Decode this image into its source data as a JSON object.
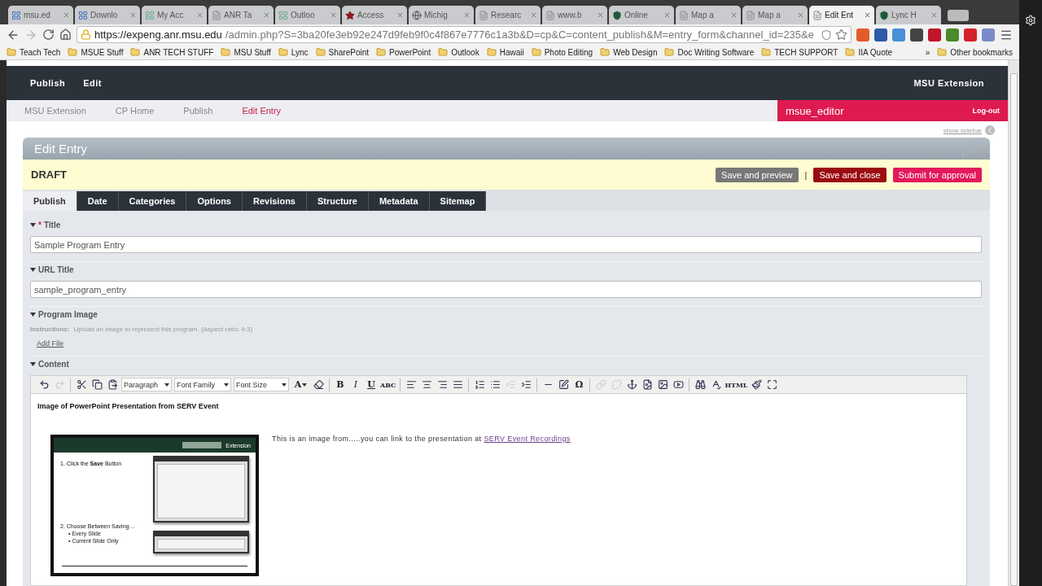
{
  "browser": {
    "tabs": [
      {
        "title": "msu.ed",
        "selected": false
      },
      {
        "title": "Downlo",
        "selected": false
      },
      {
        "title": "My Acc",
        "selected": false
      },
      {
        "title": "ANR Ta",
        "selected": false
      },
      {
        "title": "Outloo",
        "selected": false
      },
      {
        "title": "Access",
        "selected": false
      },
      {
        "title": "Michig",
        "selected": false
      },
      {
        "title": "Researc",
        "selected": false
      },
      {
        "title": "www.b",
        "selected": false
      },
      {
        "title": "Online",
        "selected": false
      },
      {
        "title": "Map a",
        "selected": false
      },
      {
        "title": "Map a",
        "selected": false
      },
      {
        "title": "Edit Ent",
        "selected": true
      },
      {
        "title": "Lync H",
        "selected": false
      }
    ],
    "url_host": "https://expeng.anr.msu.edu",
    "url_path": "/admin.php?S=3ba20fe3eb92e247d9feb9f0c4f867e7776c1a3b&D=cp&C=content_publish&M=entry_form&channel_id=235&e",
    "bookmarks": [
      "Teach Tech",
      "MSUE Stuff",
      "ANR TECH STUFF",
      "MSU Stuff",
      "Lync",
      "SharePoint",
      "PowerPoint",
      "Outlook",
      "Hawaii",
      "Photo Editing",
      "Web Design",
      "Doc Writing Software",
      "TECH SUPPORT",
      "IIA Quote"
    ],
    "more": "»",
    "other_bookmarks": "Other bookmarks"
  },
  "nav": {
    "items": [
      "Publish",
      "Edit"
    ],
    "site": "MSU Extension"
  },
  "breadcrumb": [
    {
      "label": "MSU Extension",
      "selected": false
    },
    {
      "label": "CP Home",
      "selected": false
    },
    {
      "label": "Publish",
      "selected": false
    },
    {
      "label": "Edit Entry",
      "selected": true
    }
  ],
  "user": {
    "name": "msue_editor",
    "logout": "Log-out"
  },
  "show_sidebar": "show sidebar",
  "panel": {
    "title": "Edit Entry",
    "status": "DRAFT",
    "actions": [
      {
        "label": "Save and preview",
        "color": "#777777"
      },
      {
        "label": "Save and close",
        "color": "#9b0b12"
      },
      {
        "label": "Submit for approval",
        "color": "#e2195a"
      }
    ],
    "separator": "|",
    "tabs": [
      {
        "label": "Publish",
        "selected": true
      },
      {
        "label": "Date",
        "selected": false
      },
      {
        "label": "Categories",
        "selected": false
      },
      {
        "label": "Options",
        "selected": false
      },
      {
        "label": "Revisions",
        "selected": false
      },
      {
        "label": "Structure",
        "selected": false
      },
      {
        "label": "Metadata",
        "selected": false
      },
      {
        "label": "Sitemap",
        "selected": false
      }
    ],
    "fields": [
      {
        "kind": "text",
        "label": "Title",
        "required_mark": "*",
        "value": "Sample Program Entry"
      },
      {
        "kind": "text",
        "label": "URL Title",
        "value": "sample_program_entry"
      },
      {
        "kind": "file",
        "label": "Program Image",
        "instructions_label": "Instructions:",
        "instructions": "Upload an image to represent this program. (Aspect ratio: 4:3)",
        "link": "Add File"
      }
    ],
    "content": {
      "label": "Content",
      "toolbar": [
        {
          "kind": "undo",
          "disabled": false
        },
        {
          "kind": "redo",
          "disabled": true
        },
        {
          "kind": "sep"
        },
        {
          "kind": "cut",
          "disabled": false
        },
        {
          "kind": "copy",
          "disabled": false
        },
        {
          "kind": "paste",
          "disabled": false
        },
        {
          "kind": "select",
          "text": "Paragraph"
        },
        {
          "kind": "select",
          "text": "Font Family"
        },
        {
          "kind": "select",
          "text": "Font Size"
        },
        {
          "kind": "color",
          "text": "A"
        },
        {
          "kind": "eraser",
          "disabled": false
        },
        {
          "kind": "sep"
        },
        {
          "kind": "glyph",
          "text": "B"
        },
        {
          "kind": "glyph",
          "text": "I"
        },
        {
          "kind": "glyph",
          "text": "U"
        },
        {
          "kind": "glyph",
          "text": "ABC"
        },
        {
          "kind": "sep"
        },
        {
          "kind": "align-left",
          "disabled": false
        },
        {
          "kind": "align-center",
          "disabled": false
        },
        {
          "kind": "align-right",
          "disabled": false
        },
        {
          "kind": "align-justify",
          "disabled": false
        },
        {
          "kind": "sep"
        },
        {
          "kind": "list-ordered",
          "disabled": false
        },
        {
          "kind": "list",
          "disabled": false
        },
        {
          "kind": "outdent",
          "disabled": true
        },
        {
          "kind": "indent",
          "disabled": false
        },
        {
          "kind": "sep"
        },
        {
          "kind": "rule",
          "disabled": false
        },
        {
          "kind": "edit",
          "disabled": false
        },
        {
          "kind": "glyph",
          "text": "Ω"
        },
        {
          "kind": "sep"
        },
        {
          "kind": "link",
          "disabled": true
        },
        {
          "kind": "unlink",
          "disabled": true
        },
        {
          "kind": "anchor",
          "disabled": false
        },
        {
          "kind": "file",
          "disabled": false
        },
        {
          "kind": "image",
          "disabled": false
        },
        {
          "kind": "video",
          "disabled": false
        },
        {
          "kind": "sep"
        },
        {
          "kind": "find",
          "disabled": false
        },
        {
          "kind": "spell",
          "disabled": false
        },
        {
          "kind": "glyph",
          "text": "HTML"
        },
        {
          "kind": "clean",
          "disabled": false
        },
        {
          "kind": "fullscreen",
          "disabled": false
        }
      ],
      "heading": "Image of PowerPoint Presentation from SERV Event",
      "caption": "This is an image from.....you can link to the presentation at",
      "caption_link": "SERV Event Recordings",
      "slide": {
        "brand": "Extension",
        "step1": "1. Click the **Save** Button",
        "step2": "2. Choose Between Saving…",
        "bullet": "•",
        "bullets": [
          "Every Slide",
          "Current Slide Only"
        ]
      }
    }
  }
}
